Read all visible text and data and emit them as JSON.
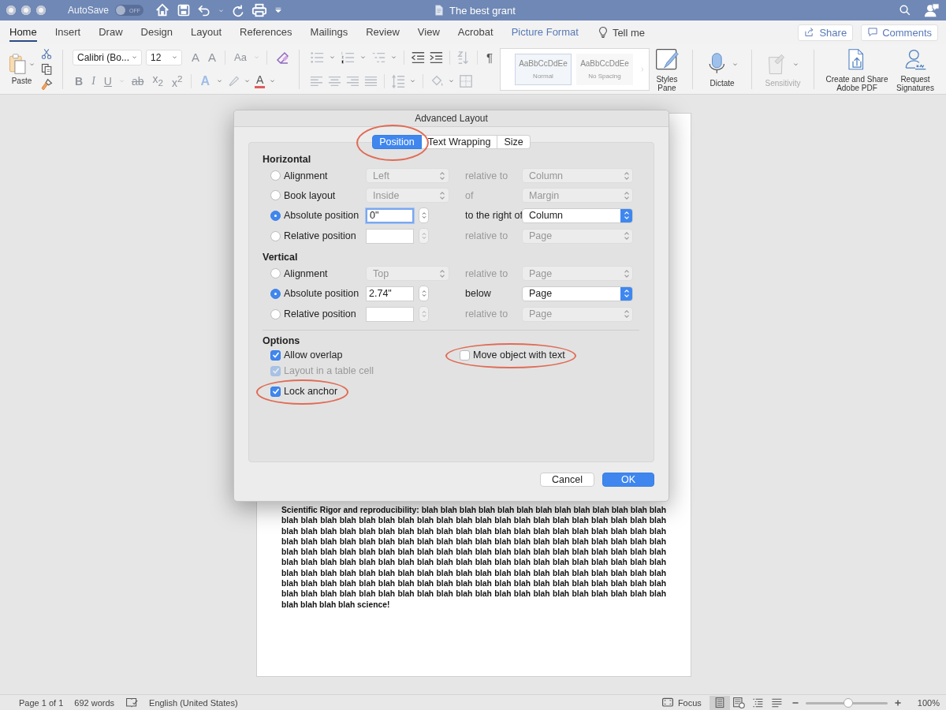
{
  "window": {
    "title": "The best grant"
  },
  "quick_access": {
    "autosave_label": "AutoSave",
    "autosave_toggle": {
      "on": false,
      "text": "OFF"
    }
  },
  "ribbon_tabs": [
    {
      "label": "Home",
      "selected": true,
      "kind": "normal"
    },
    {
      "label": "Insert",
      "selected": false,
      "kind": "normal"
    },
    {
      "label": "Draw",
      "selected": false,
      "kind": "normal"
    },
    {
      "label": "Design",
      "selected": false,
      "kind": "normal"
    },
    {
      "label": "Layout",
      "selected": false,
      "kind": "normal"
    },
    {
      "label": "References",
      "selected": false,
      "kind": "normal"
    },
    {
      "label": "Mailings",
      "selected": false,
      "kind": "normal"
    },
    {
      "label": "Review",
      "selected": false,
      "kind": "normal"
    },
    {
      "label": "View",
      "selected": false,
      "kind": "normal"
    },
    {
      "label": "Acrobat",
      "selected": false,
      "kind": "normal"
    },
    {
      "label": "Picture Format",
      "selected": false,
      "kind": "contextual"
    }
  ],
  "tell_me": "Tell me",
  "header_buttons": [
    {
      "label": "Share",
      "kind": "share"
    },
    {
      "label": "Comments",
      "kind": "comments"
    }
  ],
  "ribbon": {
    "paste_label": "Paste",
    "font_name": "Calibri (Bo...",
    "font_size": "12",
    "glyphs_top": [
      {
        "glyph": "A",
        "kind": "grow"
      },
      {
        "glyph": "A",
        "kind": "shrink"
      },
      {
        "glyph": "Aa",
        "kind": "case"
      }
    ],
    "glyphs_bottom": [
      {
        "glyph": "B",
        "kind": "bold"
      },
      {
        "glyph": "I",
        "kind": "italic"
      },
      {
        "glyph": "U",
        "kind": "underline"
      },
      {
        "glyph": "ab",
        "kind": "strike"
      },
      {
        "glyph": "x$_{2}$",
        "kind": "sub"
      },
      {
        "glyph": "x$^{2}$",
        "kind": "sup"
      },
      {
        "glyph": "A",
        "kind": "effects"
      },
      {
        "glyph": "A",
        "kind": "color"
      }
    ],
    "pilcrow": "¶",
    "styles": [
      {
        "preview": "AaBbCcDdEe",
        "name": "Normal",
        "selected": true
      },
      {
        "preview": "AaBbCcDdEe",
        "name": "No Spacing",
        "selected": false
      }
    ],
    "large_buttons": [
      {
        "label": "Styles Pane",
        "kind": "styles",
        "disabled": false
      },
      {
        "label": "Dictate",
        "kind": "dictate",
        "disabled": false
      },
      {
        "label": "Sensitivity",
        "kind": "sensitivity",
        "disabled": true
      },
      {
        "label": "Create and Share Adobe PDF",
        "kind": "pdf",
        "disabled": false
      },
      {
        "label": "Request Signatures",
        "kind": "signature",
        "disabled": false
      }
    ]
  },
  "document": {
    "paragraph": "Scientific Rigor and reproducibility: blah blah blah blah blah blah blah blah blah blah blah blah blah blah blah blah blah blah blah blah blah blah blah blah blah blah blah blah blah blah blah blah blah blah blah blah blah blah blah blah blah blah blah blah blah blah blah blah blah blah blah blah blah blah blah blah blah blah blah blah blah blah blah blah blah blah blah blah blah blah blah blah blah blah blah blah blah blah blah blah blah blah blah blah blah blah blah blah blah blah blah blah blah blah blah blah blah blah blah blah blah blah blah blah blah blah blah blah blah blah blah blah blah blah blah blah blah blah blah blah blah blah blah blah blah blah blah blah blah blah blah blah blah blah blah blah blah blah blah blah blah blah blah blah blah blah blah blah blah blah blah blah blah blah blah blah blah blah blah blah blah blah blah blah blah blah blah blah blah blah blah blah blah blah blah blah blah science!"
  },
  "dialog": {
    "title": "Advanced Layout",
    "tabs": [
      {
        "label": "Position",
        "selected": true,
        "circled": true
      },
      {
        "label": "Text Wrapping",
        "selected": false,
        "circled": false
      },
      {
        "label": "Size",
        "selected": false,
        "circled": false
      }
    ],
    "sections": [
      {
        "heading": "Horizontal",
        "rows": [
          {
            "label": "Alignment",
            "selected": false,
            "control": {
              "kind": "select",
              "value": "Left",
              "disabled": true
            },
            "relation": {
              "text": "relative to",
              "disabled": true
            },
            "target": {
              "value": "Column",
              "disabled": true
            }
          },
          {
            "label": "Book layout",
            "selected": false,
            "control": {
              "kind": "select",
              "value": "Inside",
              "disabled": true
            },
            "relation": {
              "text": "of",
              "disabled": true
            },
            "target": {
              "value": "Margin",
              "disabled": true
            }
          },
          {
            "label": "Absolute position",
            "selected": true,
            "control": {
              "kind": "field",
              "value": "0\"",
              "disabled": false,
              "focused": true
            },
            "relation": {
              "text": "to the right of",
              "disabled": false
            },
            "target": {
              "value": "Column",
              "disabled": false
            }
          },
          {
            "label": "Relative position",
            "selected": false,
            "control": {
              "kind": "field",
              "disabled": true,
              "focused": false
            },
            "relation": {
              "text": "relative to",
              "disabled": true
            },
            "target": {
              "value": "Page",
              "disabled": true
            }
          }
        ]
      },
      {
        "heading": "Vertical",
        "rows": [
          {
            "label": "Alignment",
            "selected": false,
            "control": {
              "kind": "select",
              "value": "Top",
              "disabled": true
            },
            "relation": {
              "text": "relative to",
              "disabled": true
            },
            "target": {
              "value": "Page",
              "disabled": true
            }
          },
          {
            "label": "Absolute position",
            "selected": true,
            "control": {
              "kind": "field",
              "value": "2.74\"",
              "disabled": false,
              "focused": false
            },
            "relation": {
              "text": "below",
              "disabled": false
            },
            "target": {
              "value": "Page",
              "disabled": false
            }
          },
          {
            "label": "Relative position",
            "selected": false,
            "control": {
              "kind": "field",
              "disabled": true,
              "focused": false
            },
            "relation": {
              "text": "relative to",
              "disabled": true
            },
            "target": {
              "value": "Page",
              "disabled": true
            }
          }
        ]
      }
    ],
    "options": {
      "heading": "Options",
      "left": [
        {
          "label": "Allow overlap",
          "checked": true,
          "disabled": false,
          "circled": false
        },
        {
          "label": "Layout in a table cell",
          "checked": true,
          "disabled": true,
          "circled": false
        },
        {
          "label": "Lock anchor",
          "checked": true,
          "disabled": false,
          "circled": true
        }
      ],
      "right": [
        {
          "label": "Move object with text",
          "checked": false,
          "disabled": false,
          "circled": true
        }
      ]
    },
    "buttons": [
      {
        "label": "Cancel",
        "kind": "normal"
      },
      {
        "label": "OK",
        "kind": "default"
      }
    ]
  },
  "status_bar": {
    "page": "Page 1 of 1",
    "words": "692 words",
    "language": "English (United States)",
    "focus": "Focus",
    "views": [
      {
        "kind": "print",
        "selected": true
      },
      {
        "kind": "web",
        "selected": false
      },
      {
        "kind": "outline",
        "selected": false
      },
      {
        "kind": "draft",
        "selected": false
      }
    ],
    "zoom": {
      "level": 0.52,
      "reading": "100%"
    }
  }
}
